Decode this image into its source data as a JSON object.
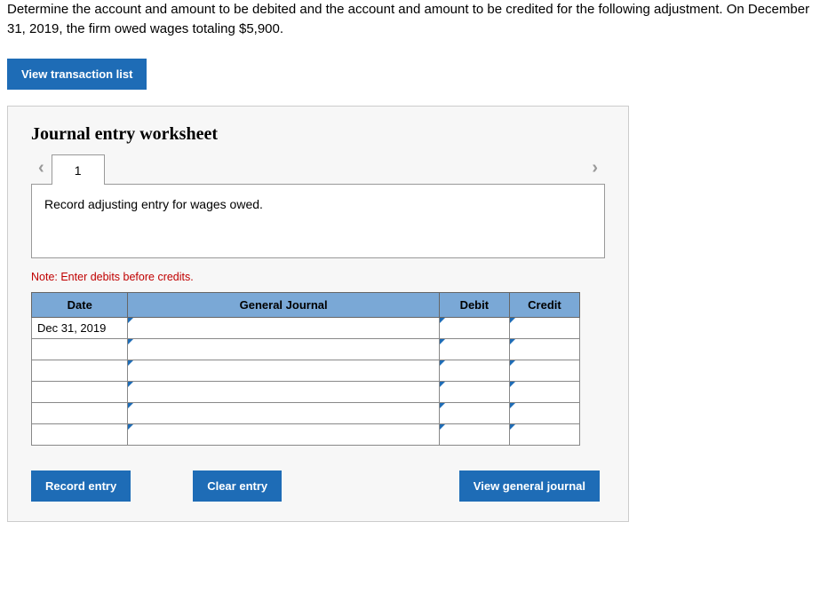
{
  "question": "Determine the account and amount to be debited and the account and amount to be credited for the following adjustment. On December 31, 2019, the firm owed wages totaling $5,900.",
  "view_btn": "View transaction list",
  "worksheet_title": "Journal entry worksheet",
  "tab_label": "1",
  "instruction": "Record adjusting entry for wages owed.",
  "note": "Note: Enter debits before credits.",
  "headers": {
    "date": "Date",
    "gj": "General Journal",
    "debit": "Debit",
    "credit": "Credit"
  },
  "rows": [
    {
      "date": "Dec 31, 2019",
      "gj": "",
      "debit": "",
      "credit": ""
    },
    {
      "date": "",
      "gj": "",
      "debit": "",
      "credit": ""
    },
    {
      "date": "",
      "gj": "",
      "debit": "",
      "credit": ""
    },
    {
      "date": "",
      "gj": "",
      "debit": "",
      "credit": ""
    },
    {
      "date": "",
      "gj": "",
      "debit": "",
      "credit": ""
    },
    {
      "date": "",
      "gj": "",
      "debit": "",
      "credit": ""
    }
  ],
  "actions": {
    "record": "Record entry",
    "clear": "Clear entry",
    "view_gj": "View general journal"
  }
}
